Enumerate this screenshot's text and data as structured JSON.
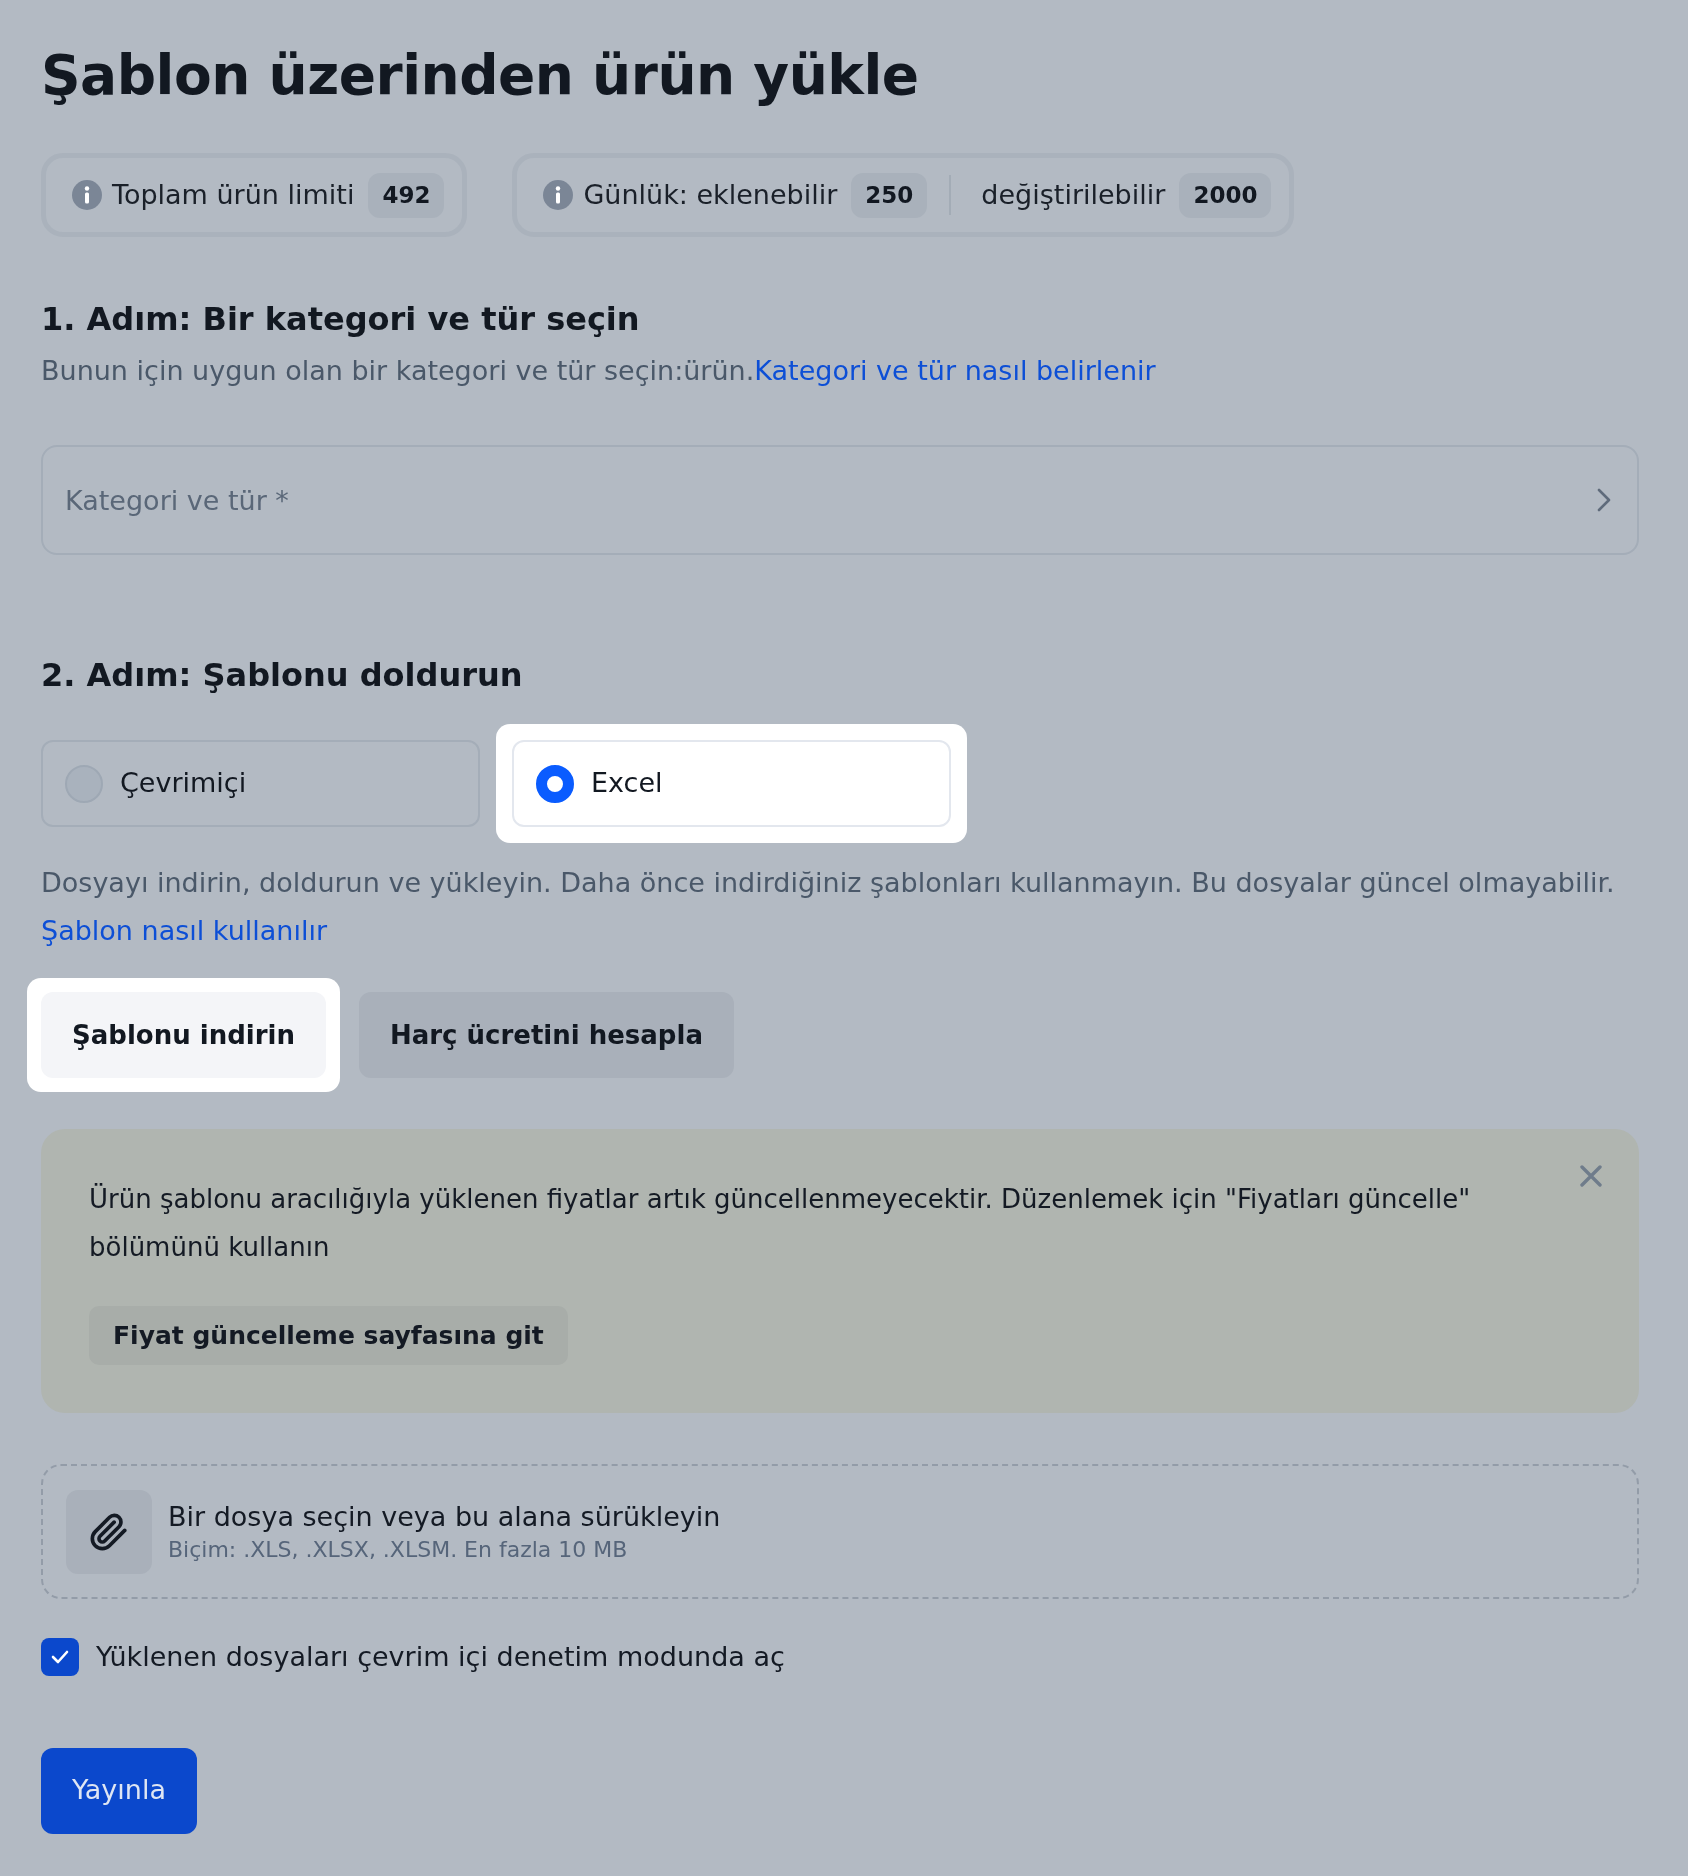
{
  "page": {
    "title": "Şablon üzerinden ürün yükle"
  },
  "limit_pills": [
    {
      "entries": [
        {
          "label": "Toplam ürün limiti",
          "count": "492"
        }
      ]
    },
    {
      "entries": [
        {
          "label": "Günlük: eklenebilir",
          "count": "250"
        },
        {
          "label": "değiştirilebilir",
          "count": "2000"
        }
      ]
    }
  ],
  "step_1": {
    "heading": "1. Adım: Bir kategori ve tür seçin",
    "description": "Bunun için uygun olan bir kategori ve tür seçin:ürün.",
    "link": "Kategori ve tür nasıl belirlenir",
    "field": {
      "placeholder": "Kategori ve tür *"
    }
  },
  "step_2": {
    "heading": "2. Adım: Şablonu doldurun",
    "options": [
      {
        "label": "Çevrimiçi",
        "selected": false,
        "highlighted": false
      },
      {
        "label": "Excel",
        "selected": true,
        "highlighted": true
      }
    ],
    "description": "Dosyayı indirin, doldurun ve yükleyin. Daha önce indirdiğiniz şablonları kullanmayın. Bu dosyalar güncel olmayabilir.",
    "link": "Şablon nasıl kullanılır",
    "buttons": [
      {
        "label": "Şablonu indirin",
        "highlighted": true
      },
      {
        "label": "Harç ücretini hesapla",
        "highlighted": false
      }
    ]
  },
  "notice": {
    "text": "Ürün şablonu aracılığıyla yüklenen fiyatlar artık güncellenmeyecektir. Düzenlemek için \"Fiyatları güncelle\" bölümünü kullanın",
    "button": "Fiyat güncelleme sayfasına git"
  },
  "upload": {
    "title": "Bir dosya seçin veya bu alana sürükleyin",
    "hint": "Biçim: .XLS, .XLSX, .XLSM. En fazla 10 MB"
  },
  "checkbox": {
    "label": "Yüklenen dosyaları çevrim içi denetim modunda aç",
    "checked": true
  },
  "publish_button": {
    "label": "Yayınla"
  }
}
